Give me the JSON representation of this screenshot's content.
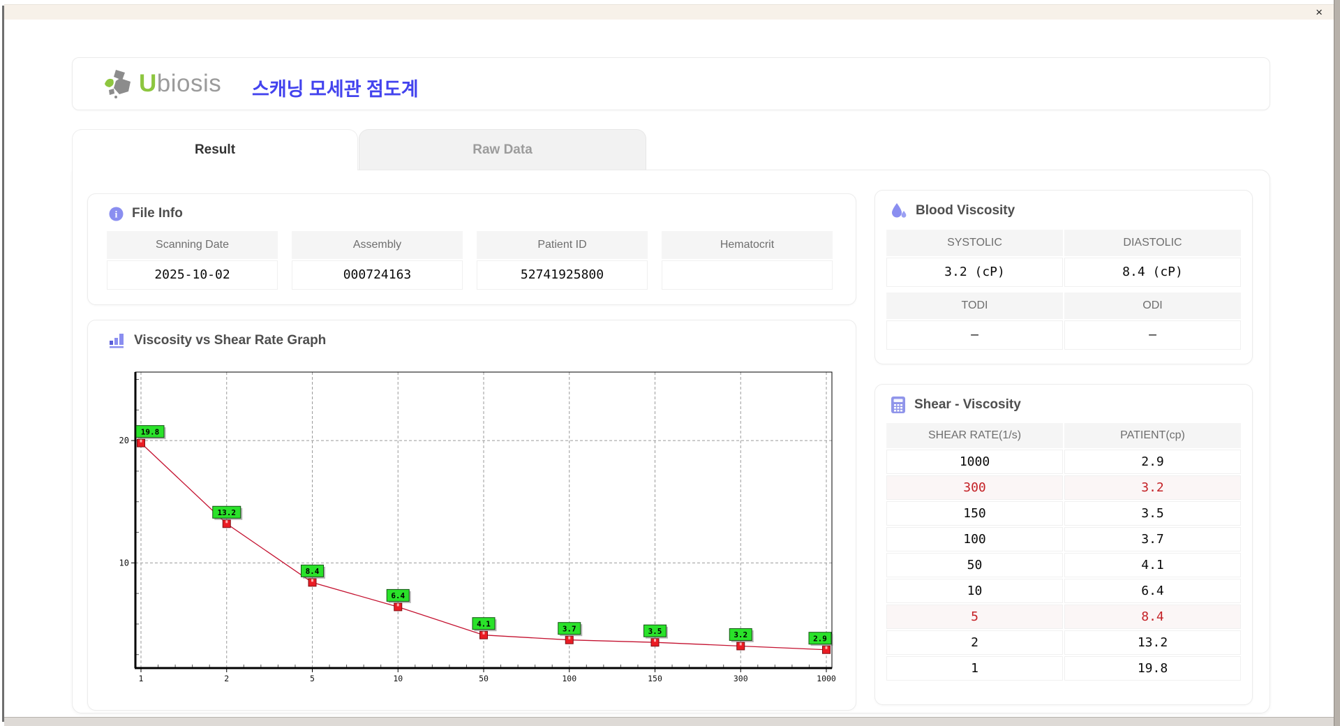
{
  "window": {
    "close_glyph": "×"
  },
  "header": {
    "logo_u": "U",
    "logo_rest": "biosis",
    "app_title": "스캐닝 모세관 점도계"
  },
  "tabs": [
    {
      "label": "Result",
      "active": true
    },
    {
      "label": "Raw Data",
      "active": false
    }
  ],
  "file_info": {
    "title": "File Info",
    "fields": [
      {
        "label": "Scanning Date",
        "value": "2025-10-02"
      },
      {
        "label": "Assembly",
        "value": "000724163"
      },
      {
        "label": "Patient ID",
        "value": "52741925800"
      },
      {
        "label": "Hematocrit",
        "value": ""
      }
    ]
  },
  "blood_viscosity": {
    "title": "Blood Viscosity",
    "groups": [
      {
        "cells": [
          {
            "label": "SYSTOLIC",
            "value": "3.2 (cP)"
          },
          {
            "label": "DIASTOLIC",
            "value": "8.4 (cP)"
          }
        ]
      },
      {
        "cells": [
          {
            "label": "TODI",
            "value": "–"
          },
          {
            "label": "ODI",
            "value": "–"
          }
        ]
      }
    ]
  },
  "shear_viscosity": {
    "title": "Shear - Viscosity",
    "columns": [
      "SHEAR RATE(1/s)",
      "PATIENT(cp)"
    ],
    "rows": [
      {
        "shear_rate": "1000",
        "patient": "2.9",
        "highlight": false
      },
      {
        "shear_rate": "300",
        "patient": "3.2",
        "highlight": true
      },
      {
        "shear_rate": "150",
        "patient": "3.5",
        "highlight": false
      },
      {
        "shear_rate": "100",
        "patient": "3.7",
        "highlight": false
      },
      {
        "shear_rate": "50",
        "patient": "4.1",
        "highlight": false
      },
      {
        "shear_rate": "10",
        "patient": "6.4",
        "highlight": false
      },
      {
        "shear_rate": "5",
        "patient": "8.4",
        "highlight": true
      },
      {
        "shear_rate": "2",
        "patient": "13.2",
        "highlight": false
      },
      {
        "shear_rate": "1",
        "patient": "19.8",
        "highlight": false
      }
    ],
    "highlight_color": "#c42126"
  },
  "graph": {
    "title": "Viscosity vs Shear Rate Graph"
  },
  "chart_data": {
    "type": "line",
    "title": "Viscosity vs Shear Rate Graph",
    "x_scale": "category",
    "categories": [
      1,
      2,
      5,
      10,
      50,
      100,
      150,
      300,
      1000
    ],
    "series": [
      {
        "name": "PATIENT(cp)",
        "values": [
          19.8,
          13.2,
          8.4,
          6.4,
          4.1,
          3.7,
          3.5,
          3.2,
          2.9
        ]
      }
    ],
    "xlabel": "",
    "ylabel": "",
    "ylim": [
      1.4,
      25.6
    ],
    "y_major_ticks": [
      10,
      20
    ],
    "y_minor_tick_step": 2.5,
    "x_minor_ticks_between": 4,
    "grid": "dashed",
    "legend": false,
    "colors": {
      "line": "#c41230",
      "marker_fill": "#ea1c24",
      "marker_stroke": "#7e0d12",
      "marker_notch": "#ffb0b0",
      "label_bg": "#2ae22a",
      "label_border": "#145214",
      "label_text": "#000000",
      "grid": "#9a9a9a",
      "axis": "#000000",
      "accent": "#8a8ef0"
    }
  }
}
